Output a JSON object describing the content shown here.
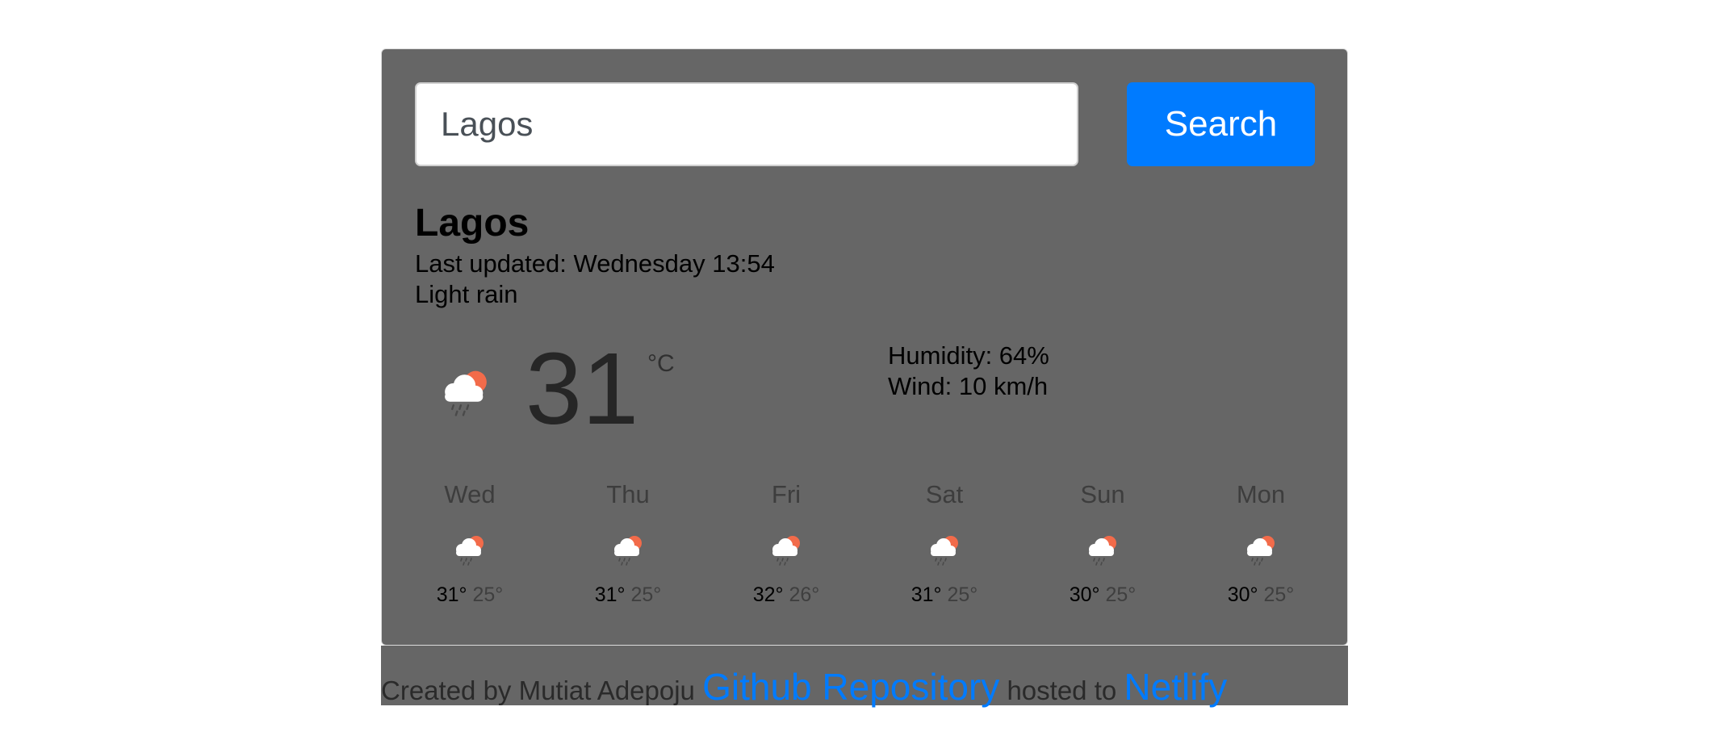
{
  "search": {
    "value": "Lagos",
    "button_label": "Search"
  },
  "current": {
    "city": "Lagos",
    "last_updated": "Last updated: Wednesday 13:54",
    "description": "Light rain",
    "temperature": "31",
    "unit": "°C",
    "humidity": "Humidity: 64%",
    "wind": "Wind: 10 km/h",
    "icon": "light-rain-icon"
  },
  "forecast": [
    {
      "day": "Wed",
      "max": "31°",
      "min": "25°",
      "icon": "light-rain-icon"
    },
    {
      "day": "Thu",
      "max": "31°",
      "min": "25°",
      "icon": "light-rain-icon"
    },
    {
      "day": "Fri",
      "max": "32°",
      "min": "26°",
      "icon": "light-rain-icon"
    },
    {
      "day": "Sat",
      "max": "31°",
      "min": "25°",
      "icon": "light-rain-icon"
    },
    {
      "day": "Sun",
      "max": "30°",
      "min": "25°",
      "icon": "light-rain-icon"
    },
    {
      "day": "Mon",
      "max": "30°",
      "min": "25°",
      "icon": "light-rain-icon"
    }
  ],
  "footer": {
    "prefix": "Created by Mutiat Adepoju",
    "github_label": "Github Repository",
    "middle": "hosted to",
    "netlify_label": "Netlify"
  },
  "colors": {
    "accent": "#007bff",
    "card_background": "#666666",
    "sun": "#f26b4a"
  }
}
